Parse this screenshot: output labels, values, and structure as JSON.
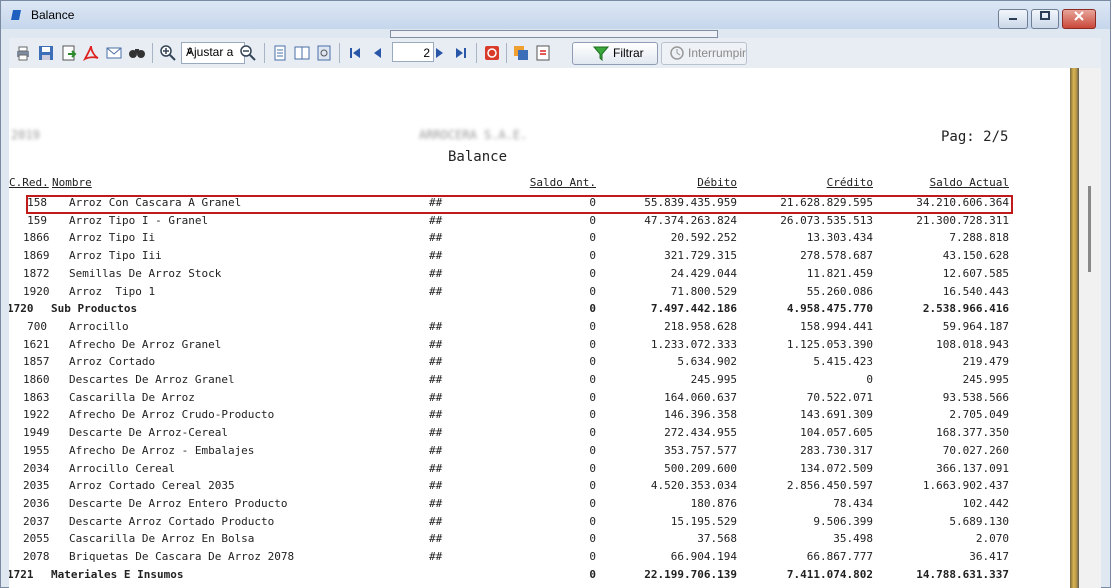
{
  "window": {
    "title": "Balance"
  },
  "toolbar": {
    "zoom_value": "Ajustar a",
    "page_value": "2",
    "filter_label": "Filtrar",
    "interrupt_label": "Interrumpir"
  },
  "report": {
    "left_header_redacted": "2019",
    "center_header_redacted": "ARROCERA S.A.E.",
    "page_label": "Pag: 2/5",
    "title": "Balance",
    "columns": {
      "cred": "C.Red.",
      "nombre": "Nombre",
      "saldo_ant": "Saldo Ant.",
      "debito": "Débito",
      "credito": "Crédito",
      "saldo_actual": "Saldo Actual"
    },
    "rows": [
      {
        "code": "158",
        "name": "Arroz Con Cascara A Granel",
        "flag": "##",
        "ant": "0",
        "deb": "55.839.435.959",
        "cre": "21.628.829.595",
        "sal": "34.210.606.364",
        "bold": false
      },
      {
        "code": "159",
        "name": "Arroz Tipo I - Granel",
        "flag": "##",
        "ant": "0",
        "deb": "47.374.263.824",
        "cre": "26.073.535.513",
        "sal": "21.300.728.311",
        "bold": false
      },
      {
        "code": "1866",
        "name": "Arroz Tipo Ii",
        "flag": "##",
        "ant": "0",
        "deb": "20.592.252",
        "cre": "13.303.434",
        "sal": "7.288.818",
        "bold": false
      },
      {
        "code": "1869",
        "name": "Arroz Tipo Iii",
        "flag": "##",
        "ant": "0",
        "deb": "321.729.315",
        "cre": "278.578.687",
        "sal": "43.150.628",
        "bold": false
      },
      {
        "code": "1872",
        "name": "Semillas De Arroz Stock",
        "flag": "##",
        "ant": "0",
        "deb": "24.429.044",
        "cre": "11.821.459",
        "sal": "12.607.585",
        "bold": false
      },
      {
        "code": "1920",
        "name": "Arroz  Tipo 1",
        "flag": "##",
        "ant": "0",
        "deb": "71.800.529",
        "cre": "55.260.086",
        "sal": "16.540.443",
        "bold": false
      },
      {
        "code": "1720",
        "name": "Sub Productos",
        "flag": "",
        "ant": "0",
        "deb": "7.497.442.186",
        "cre": "4.958.475.770",
        "sal": "2.538.966.416",
        "bold": true
      },
      {
        "code": "700",
        "name": "Arrocillo",
        "flag": "##",
        "ant": "0",
        "deb": "218.958.628",
        "cre": "158.994.441",
        "sal": "59.964.187",
        "bold": false
      },
      {
        "code": "1621",
        "name": "Afrecho De Arroz Granel",
        "flag": "##",
        "ant": "0",
        "deb": "1.233.072.333",
        "cre": "1.125.053.390",
        "sal": "108.018.943",
        "bold": false
      },
      {
        "code": "1857",
        "name": "Arroz Cortado",
        "flag": "##",
        "ant": "0",
        "deb": "5.634.902",
        "cre": "5.415.423",
        "sal": "219.479",
        "bold": false
      },
      {
        "code": "1860",
        "name": "Descartes De Arroz Granel",
        "flag": "##",
        "ant": "0",
        "deb": "245.995",
        "cre": "0",
        "sal": "245.995",
        "bold": false
      },
      {
        "code": "1863",
        "name": "Cascarilla De Arroz",
        "flag": "##",
        "ant": "0",
        "deb": "164.060.637",
        "cre": "70.522.071",
        "sal": "93.538.566",
        "bold": false
      },
      {
        "code": "1922",
        "name": "Afrecho De Arroz Crudo-Producto",
        "flag": "##",
        "ant": "0",
        "deb": "146.396.358",
        "cre": "143.691.309",
        "sal": "2.705.049",
        "bold": false
      },
      {
        "code": "1949",
        "name": "Descarte De Arroz-Cereal",
        "flag": "##",
        "ant": "0",
        "deb": "272.434.955",
        "cre": "104.057.605",
        "sal": "168.377.350",
        "bold": false
      },
      {
        "code": "1955",
        "name": "Afrecho De Arroz - Embalajes",
        "flag": "##",
        "ant": "0",
        "deb": "353.757.577",
        "cre": "283.730.317",
        "sal": "70.027.260",
        "bold": false
      },
      {
        "code": "2034",
        "name": "Arrocillo Cereal",
        "flag": "##",
        "ant": "0",
        "deb": "500.209.600",
        "cre": "134.072.509",
        "sal": "366.137.091",
        "bold": false
      },
      {
        "code": "2035",
        "name": "Arroz Cortado Cereal 2035",
        "flag": "##",
        "ant": "0",
        "deb": "4.520.353.034",
        "cre": "2.856.450.597",
        "sal": "1.663.902.437",
        "bold": false
      },
      {
        "code": "2036",
        "name": "Descarte De Arroz Entero Producto",
        "flag": "##",
        "ant": "0",
        "deb": "180.876",
        "cre": "78.434",
        "sal": "102.442",
        "bold": false
      },
      {
        "code": "2037",
        "name": "Descarte Arroz Cortado Producto",
        "flag": "##",
        "ant": "0",
        "deb": "15.195.529",
        "cre": "9.506.399",
        "sal": "5.689.130",
        "bold": false
      },
      {
        "code": "2055",
        "name": "Cascarilla De Arroz En Bolsa",
        "flag": "##",
        "ant": "0",
        "deb": "37.568",
        "cre": "35.498",
        "sal": "2.070",
        "bold": false
      },
      {
        "code": "2078",
        "name": "Briquetas De Cascara De Arroz 2078",
        "flag": "##",
        "ant": "0",
        "deb": "66.904.194",
        "cre": "66.867.777",
        "sal": "36.417",
        "bold": false
      },
      {
        "code": "1721",
        "name": "Materiales E Insumos",
        "flag": "",
        "ant": "0",
        "deb": "22.199.706.139",
        "cre": "7.411.074.802",
        "sal": "14.788.631.337",
        "bold": true
      }
    ]
  }
}
